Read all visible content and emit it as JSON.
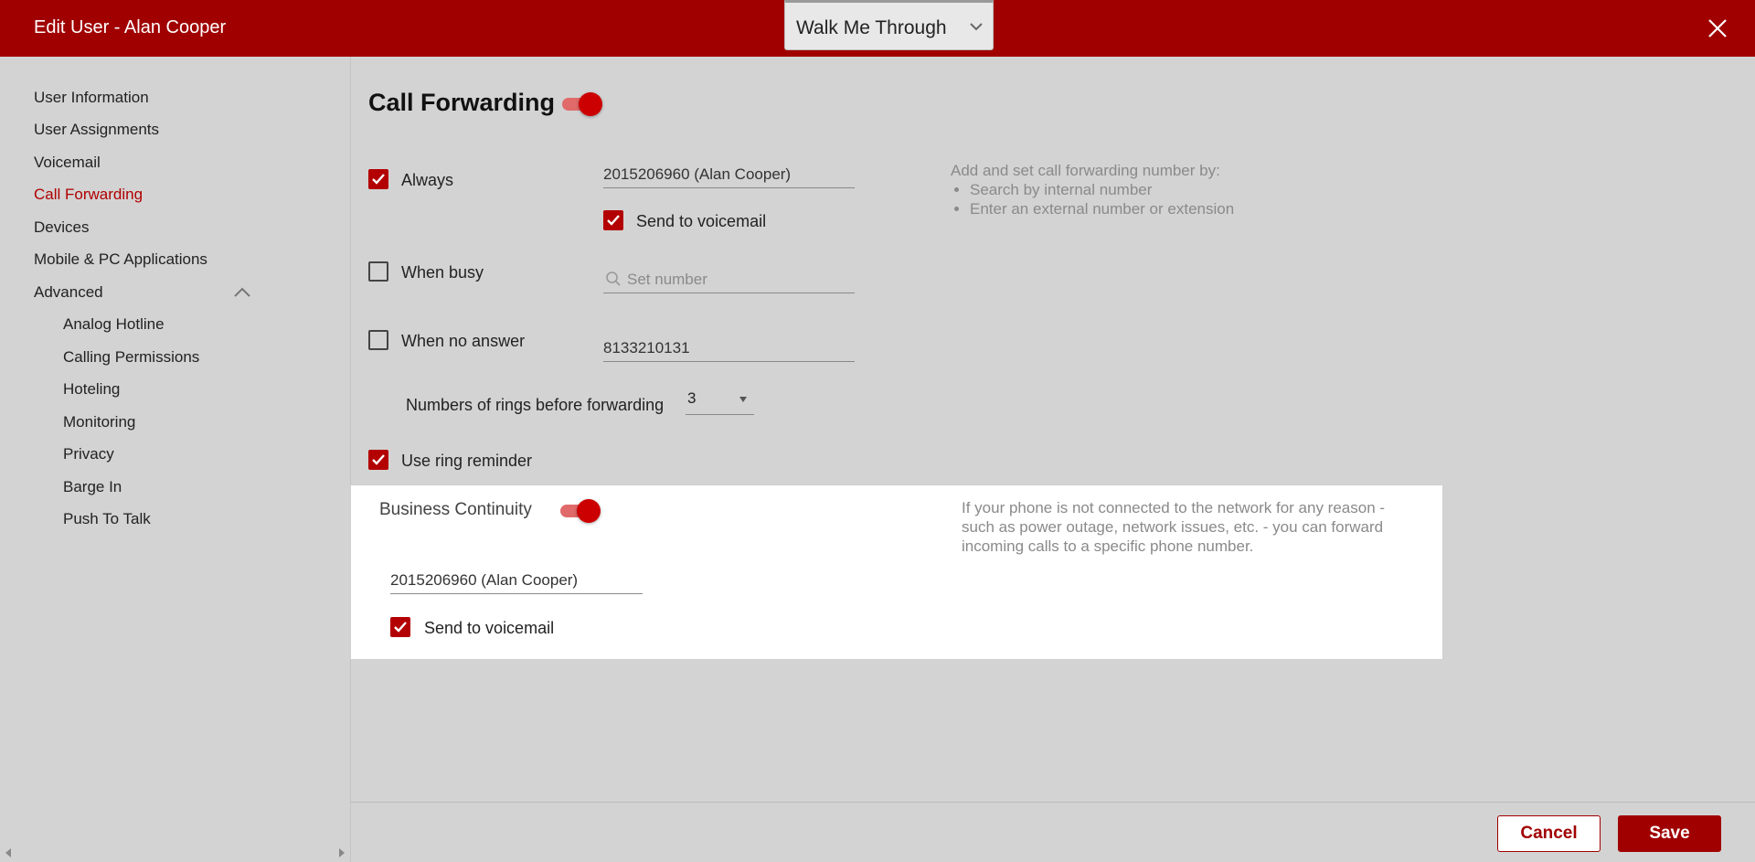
{
  "window": {
    "title": "Edit User - Alan Cooper"
  },
  "walkme": {
    "label": "Walk Me Through"
  },
  "sidebar": {
    "items": [
      {
        "label": "User Information"
      },
      {
        "label": "User Assignments"
      },
      {
        "label": "Voicemail"
      },
      {
        "label": "Call Forwarding",
        "active": true
      },
      {
        "label": "Devices"
      },
      {
        "label": "Mobile & PC Applications"
      },
      {
        "label": "Advanced"
      }
    ],
    "advanced_items": [
      {
        "label": "Analog Hotline"
      },
      {
        "label": "Calling Permissions"
      },
      {
        "label": "Hoteling"
      },
      {
        "label": "Monitoring"
      },
      {
        "label": "Privacy"
      },
      {
        "label": "Barge In"
      },
      {
        "label": "Push To Talk"
      }
    ]
  },
  "call_forwarding": {
    "title": "Call Forwarding",
    "enabled": true,
    "always": {
      "label": "Always",
      "checked": true,
      "number": "2015206960 (Alan Cooper)",
      "send_to_voicemail": {
        "label": "Send to voicemail",
        "checked": true
      }
    },
    "when_busy": {
      "label": "When busy",
      "checked": false,
      "placeholder": "Set number"
    },
    "when_no_answer": {
      "label": "When no answer",
      "checked": false,
      "number": "8133210131"
    },
    "rings": {
      "label": "Numbers of rings before forwarding",
      "value": "3"
    },
    "ring_reminder": {
      "label": "Use ring reminder",
      "checked": true
    },
    "help": {
      "intro": "Add and set call forwarding number by:",
      "bullets": [
        "Search by internal number",
        "Enter an external number or extension"
      ]
    }
  },
  "business_continuity": {
    "title": "Business Continuity",
    "enabled": true,
    "number": "2015206960 (Alan Cooper)",
    "send_to_voicemail": {
      "label": "Send to voicemail",
      "checked": true
    },
    "help": "If your phone is not connected to the network for any reason - such as power outage, network issues, etc. - you can forward incoming calls to a specific phone number."
  },
  "footer": {
    "cancel_label": "Cancel",
    "save_label": "Save"
  },
  "colors": {
    "brand": "#a00000",
    "accent": "#cc0000"
  }
}
